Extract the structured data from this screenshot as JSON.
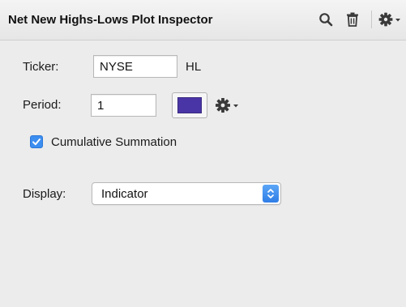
{
  "inspector": {
    "title": "Net New Highs-Lows Plot Inspector",
    "toolbar": {
      "search_icon": "search-icon",
      "trash_icon": "trash-icon",
      "gear_icon": "gear-icon"
    }
  },
  "form": {
    "ticker": {
      "label": "Ticker:",
      "value": "NYSE",
      "suffix": "HL"
    },
    "period": {
      "label": "Period:",
      "value": "1",
      "color": "#4a35a6"
    },
    "cumulative": {
      "label": "Cumulative Summation",
      "checked": true
    },
    "display": {
      "label": "Display:",
      "value": "Indicator"
    }
  },
  "colors": {
    "accent": "#3c8ef0",
    "swatch": "#4a35a6"
  }
}
